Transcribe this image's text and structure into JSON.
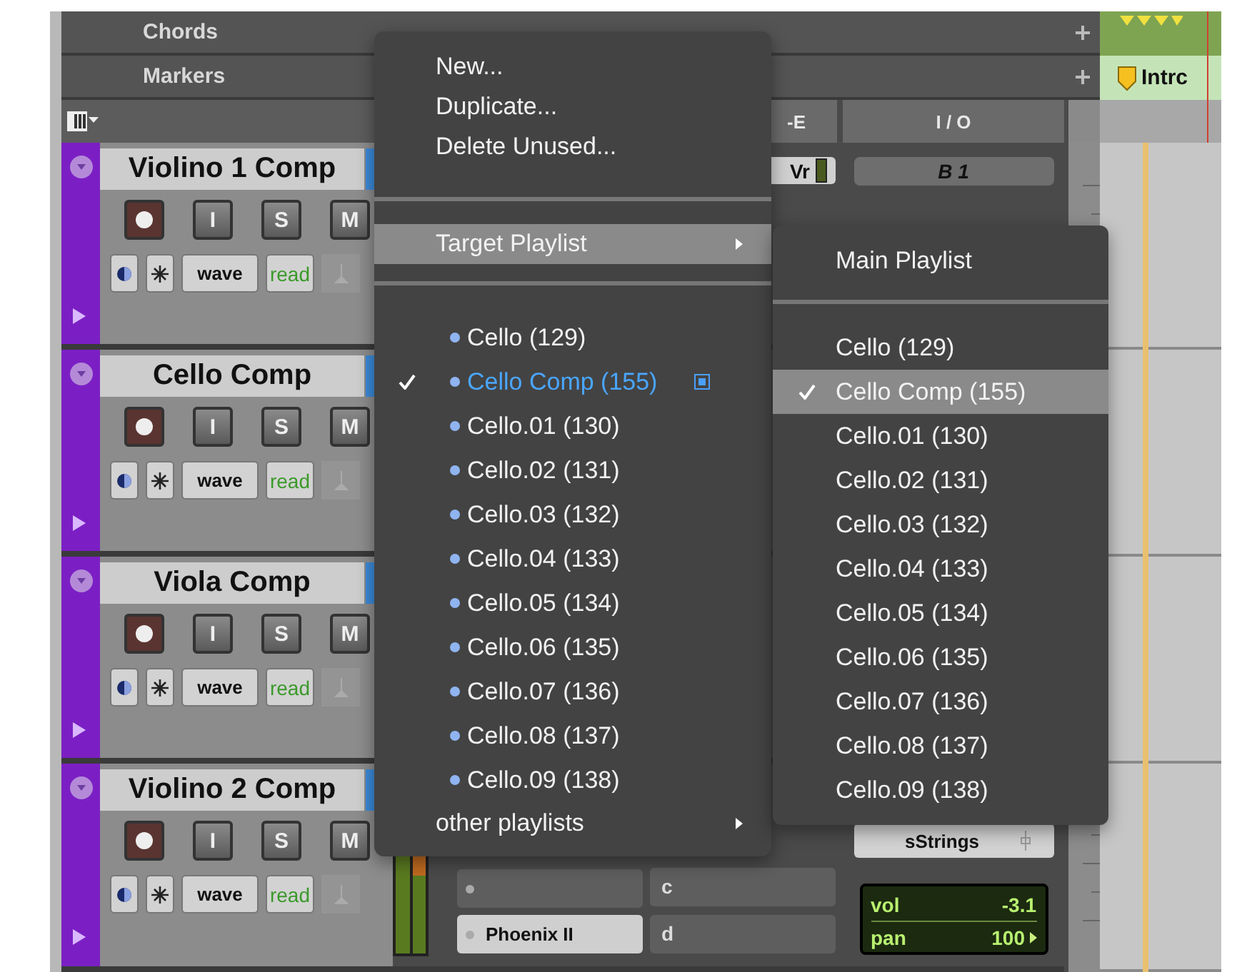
{
  "rulers": [
    {
      "label": "Chords"
    },
    {
      "label": "Markers"
    }
  ],
  "marker": {
    "label": "Intrc"
  },
  "headers": {
    "sends": "-E",
    "io": "I / O"
  },
  "tracks": [
    {
      "name": "Violino 1 Comp",
      "input": "I",
      "solo": "S",
      "mute": "M",
      "view": "wave",
      "automation": "read",
      "send": "Vr",
      "output": "B 1"
    },
    {
      "name": "Cello Comp",
      "input": "I",
      "solo": "S",
      "mute": "M",
      "view": "wave",
      "automation": "read"
    },
    {
      "name": "Viola Comp",
      "input": "I",
      "solo": "S",
      "mute": "M",
      "view": "wave",
      "automation": "read"
    },
    {
      "name": "Violino 2 Comp",
      "input": "I",
      "solo": "S",
      "mute": "M",
      "view": "wave",
      "automation": "read",
      "inserts": [
        "Phoenix II"
      ],
      "sends": [
        "c",
        "d"
      ],
      "output": "sStrings",
      "volume": {
        "label": "vol",
        "value": "-3.1"
      },
      "pan": {
        "label": "pan",
        "value": "100"
      }
    }
  ],
  "playlist_menu": {
    "actions": [
      "New...",
      "Duplicate...",
      "Delete Unused..."
    ],
    "target": {
      "label": "Target Playlist",
      "highlighted": true
    },
    "playlists": [
      {
        "label": "Cello (129)",
        "selected": false
      },
      {
        "label": "Cello Comp (155)",
        "selected": true
      },
      {
        "label": "Cello.01 (130)",
        "selected": false
      },
      {
        "label": "Cello.02 (131)",
        "selected": false
      },
      {
        "label": "Cello.03 (132)",
        "selected": false
      },
      {
        "label": "Cello.04 (133)",
        "selected": false
      },
      {
        "label": "Cello.05 (134)",
        "selected": false
      },
      {
        "label": "Cello.06 (135)",
        "selected": false
      },
      {
        "label": "Cello.07 (136)",
        "selected": false
      },
      {
        "label": "Cello.08 (137)",
        "selected": false
      },
      {
        "label": "Cello.09 (138)",
        "selected": false
      }
    ],
    "other": {
      "label": "other playlists"
    }
  },
  "target_submenu": {
    "main": "Main Playlist",
    "playlists": [
      {
        "label": "Cello (129)",
        "selected": false
      },
      {
        "label": "Cello Comp (155)",
        "selected": true
      },
      {
        "label": "Cello.01 (130)",
        "selected": false
      },
      {
        "label": "Cello.02 (131)",
        "selected": false
      },
      {
        "label": "Cello.03 (132)",
        "selected": false
      },
      {
        "label": "Cello.04 (133)",
        "selected": false
      },
      {
        "label": "Cello.05 (134)",
        "selected": false
      },
      {
        "label": "Cello.06 (135)",
        "selected": false
      },
      {
        "label": "Cello.07 (136)",
        "selected": false
      },
      {
        "label": "Cello.08 (137)",
        "selected": false
      },
      {
        "label": "Cello.09 (138)",
        "selected": false
      }
    ]
  }
}
